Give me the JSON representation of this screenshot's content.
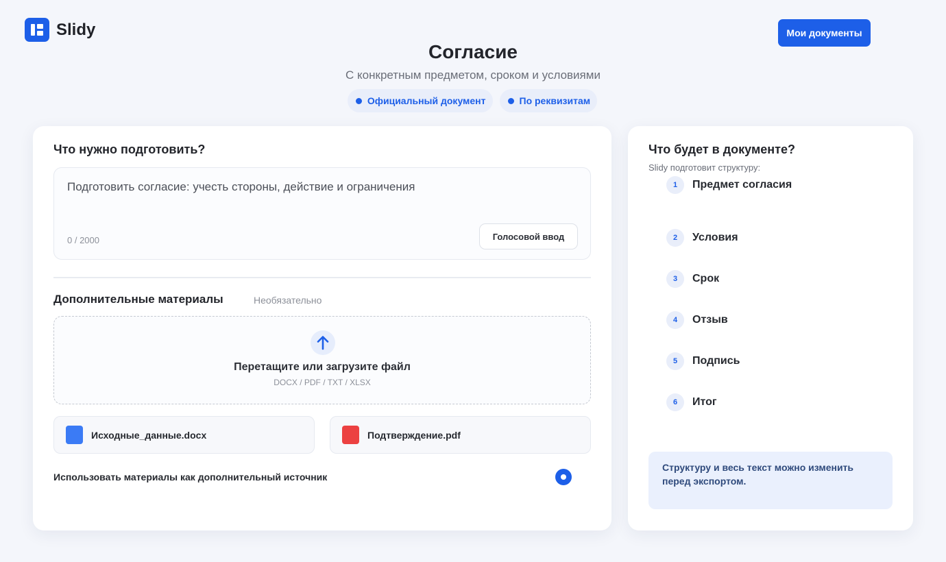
{
  "brand": {
    "name": "Slidy",
    "accent": "#1d5fe8"
  },
  "header": {
    "my_docs_label": "Мои документы"
  },
  "hero": {
    "title": "Согласие",
    "subtitle": "С конкретным предметом, сроком и условиями",
    "chips": [
      "Официальный документ",
      "По реквизитам"
    ]
  },
  "prepare": {
    "title": "Что нужно подготовить?",
    "prompt_text": "Подготовить согласие: учесть стороны, действие и ограничения",
    "counter": "0 / 2000",
    "voice_label": "Голосовой ввод"
  },
  "materials": {
    "title": "Дополнительные материалы",
    "optional": "Необязательно",
    "drop_title": "Перетащите или загрузите файл",
    "drop_formats": "DOCX / PDF / TXT / XLSX",
    "files": [
      {
        "name": "Исходные_данные.docx",
        "color": "#3b7bf5",
        "icon": "docx-file-icon"
      },
      {
        "name": "Подтверждение.pdf",
        "color": "#ec4141",
        "icon": "pdf-file-icon"
      }
    ],
    "use_as_source_label": "Использовать материалы как дополнительный источник"
  },
  "structure": {
    "title": "Что будет в документе?",
    "subtitle": "Slidy подготовит структуру:",
    "steps": [
      {
        "num": "1",
        "label": "Предмет согласия"
      },
      {
        "num": "2",
        "label": "Условия"
      },
      {
        "num": "3",
        "label": "Срок"
      },
      {
        "num": "4",
        "label": "Отзыв"
      },
      {
        "num": "5",
        "label": "Подпись"
      },
      {
        "num": "6",
        "label": "Итог"
      }
    ],
    "note": "Структуру и весь текст можно изменить перед экспортом."
  }
}
